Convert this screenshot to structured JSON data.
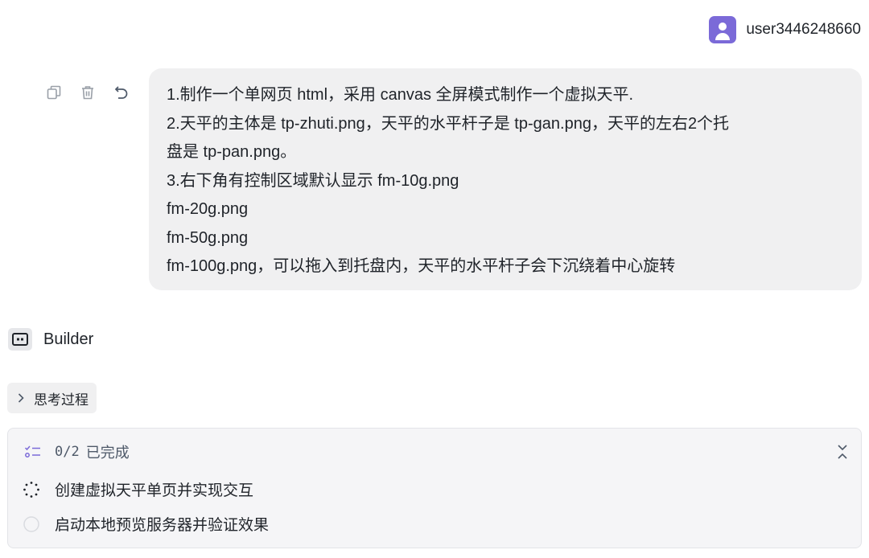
{
  "user": {
    "name": "user3446248660",
    "avatar_icon": "person-icon",
    "avatar_color": "#7b6ad8"
  },
  "message": {
    "actions": [
      {
        "icon": "copy-icon"
      },
      {
        "icon": "trash-icon"
      },
      {
        "icon": "undo-icon"
      }
    ],
    "lines": [
      "1.制作一个单网页 html，采用 canvas 全屏模式制作一个虚拟天平.",
      "2.天平的主体是 tp-zhuti.png，天平的水平杆子是 tp-gan.png，天平的左右2个托",
      "盘是 tp-pan.png。",
      "3.右下角有控制区域默认显示 fm-10g.png",
      "fm-20g.png",
      "fm-50g.png",
      "fm-100g.png，可以拖入到托盘内，天平的水平杆子会下沉绕着中心旋转"
    ]
  },
  "assistant": {
    "name": "Builder",
    "icon": "builder-icon"
  },
  "thinking": {
    "label": "思考过程",
    "icon": "chevron-right-icon"
  },
  "tasks": {
    "count": "0/2",
    "header_label": "已完成",
    "icon": "checklist-icon",
    "collapse_icon": "collapse-icon",
    "items": [
      {
        "label": "创建虚拟天平单页并实现交互",
        "status": "in-progress"
      },
      {
        "label": "启动本地预览服务器并验证效果",
        "status": "pending"
      }
    ]
  }
}
